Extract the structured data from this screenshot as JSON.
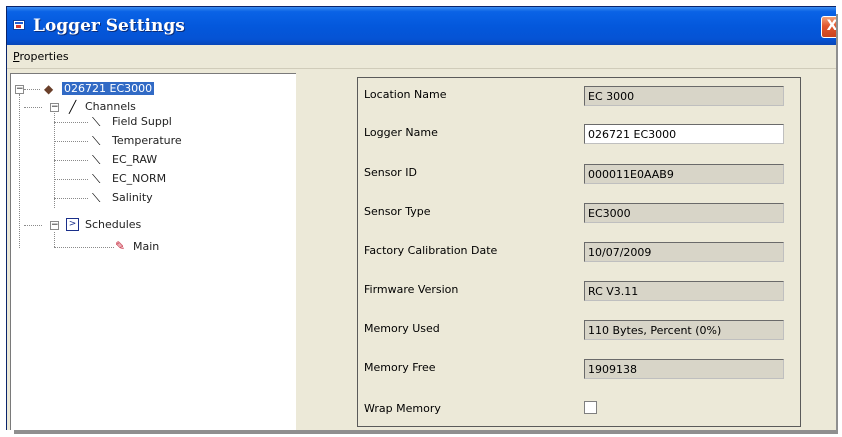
{
  "window": {
    "title": "Logger Settings",
    "close_glyph": "X"
  },
  "menu": {
    "properties": {
      "mnemonic": "P",
      "rest": "roperties"
    }
  },
  "tree": {
    "root": {
      "label": "026721 EC3000",
      "icon": "logger-icon"
    },
    "channels": {
      "label": "Channels",
      "items": [
        "Field Suppl",
        "Temperature",
        "EC_RAW",
        "EC_NORM",
        "Salinity"
      ]
    },
    "schedules": {
      "label": "Schedules",
      "items": [
        "Main"
      ]
    }
  },
  "properties": {
    "location_name": {
      "label": "Location Name",
      "value": "EC 3000"
    },
    "logger_name": {
      "label": "Logger Name",
      "value": "026721 EC3000"
    },
    "sensor_id": {
      "label": "Sensor ID",
      "value": "000011E0AAB9"
    },
    "sensor_type": {
      "label": "Sensor Type",
      "value": "EC3000"
    },
    "factory_calibration_date": {
      "label": "Factory Calibration Date",
      "value": "10/07/2009"
    },
    "firmware_version": {
      "label": "Firmware Version",
      "value": "RC V3.11"
    },
    "memory_used": {
      "label": "Memory Used",
      "value": "110 Bytes, Percent (0%)"
    },
    "memory_free": {
      "label": "Memory Free",
      "value": "1909138"
    },
    "wrap_memory": {
      "label": "Wrap Memory",
      "checked": false
    }
  },
  "colors": {
    "titlebar": "#0458dc",
    "selection": "#316ac5",
    "dialog_bg": "#ece9d8",
    "close_button": "#e2572e"
  }
}
